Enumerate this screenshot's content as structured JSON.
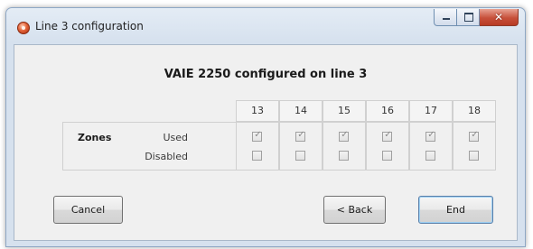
{
  "window": {
    "title": "Line 3 configuration",
    "icon": "app-icon",
    "caption_buttons": [
      "minimize-icon",
      "maximize-icon",
      "close-icon"
    ]
  },
  "heading": "VAIE 2250 configured on line 3",
  "zones": {
    "group_label": "Zones",
    "row_labels": {
      "used": "Used",
      "disabled": "Disabled"
    },
    "columns": [
      {
        "number": "13",
        "used": true,
        "disabled": false
      },
      {
        "number": "14",
        "used": true,
        "disabled": false
      },
      {
        "number": "15",
        "used": true,
        "disabled": false
      },
      {
        "number": "16",
        "used": true,
        "disabled": false
      },
      {
        "number": "17",
        "used": true,
        "disabled": false
      },
      {
        "number": "18",
        "used": true,
        "disabled": false
      }
    ]
  },
  "buttons": {
    "cancel": "Cancel",
    "back": "< Back",
    "end": "End"
  }
}
